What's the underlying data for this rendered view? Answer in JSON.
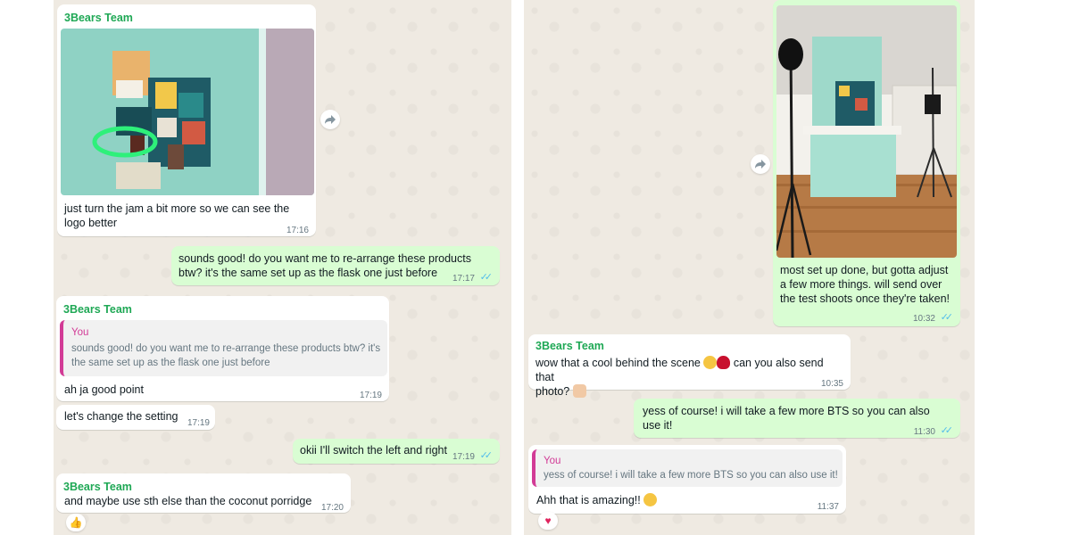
{
  "colors": {
    "chat_bg": "#efeae2",
    "incoming": "#ffffff",
    "outgoing": "#d9fdd3",
    "sender": "#1fa855",
    "quote_accent": "#d23b96",
    "read_ticks": "#53bdeb"
  },
  "left": {
    "m1": {
      "sender": "3Bears Team",
      "text": "just turn the jam a bit more so we can see the logo better",
      "time": "17:16"
    },
    "m2": {
      "text": "sounds good! do you want me to re-arrange these products btw? it's the same set up as the flask one just before",
      "time": "17:17",
      "status": "read"
    },
    "m3": {
      "sender": "3Bears Team",
      "quote_name": "You",
      "quote_text": "sounds good! do you want me to re-arrange these products btw? it's the same set up as the flask one just before",
      "text": "ah ja good point",
      "time": "17:19"
    },
    "m4": {
      "text": "let's change the setting",
      "time": "17:19"
    },
    "m5": {
      "text": "okii I'll switch the left and right",
      "time": "17:19",
      "status": "read"
    },
    "m6": {
      "sender": "3Bears Team",
      "text": "and maybe use sth else than the coconut porridge",
      "time": "17:20",
      "reaction": "thumbs-up"
    }
  },
  "right": {
    "m1": {
      "text": "most set up done, but gotta adjust a few more things. will send over the test shoots once they're taken!",
      "time": "10:32",
      "status": "read"
    },
    "m2": {
      "sender": "3Bears Team",
      "text_a": "wow that a cool behind the scene",
      "text_b": "can you also send that",
      "text_c": "photo?",
      "time": "10:35"
    },
    "m3": {
      "text": "yess of course! i will take a few more BTS so you can also use it!",
      "time": "11:30",
      "status": "read"
    },
    "m4": {
      "quote_name": "You",
      "quote_text": "yess of course! i will take a few more BTS so you can also use it!",
      "text": "Ahh that is amazing!!",
      "time": "11:37",
      "reaction": "red-heart"
    }
  }
}
